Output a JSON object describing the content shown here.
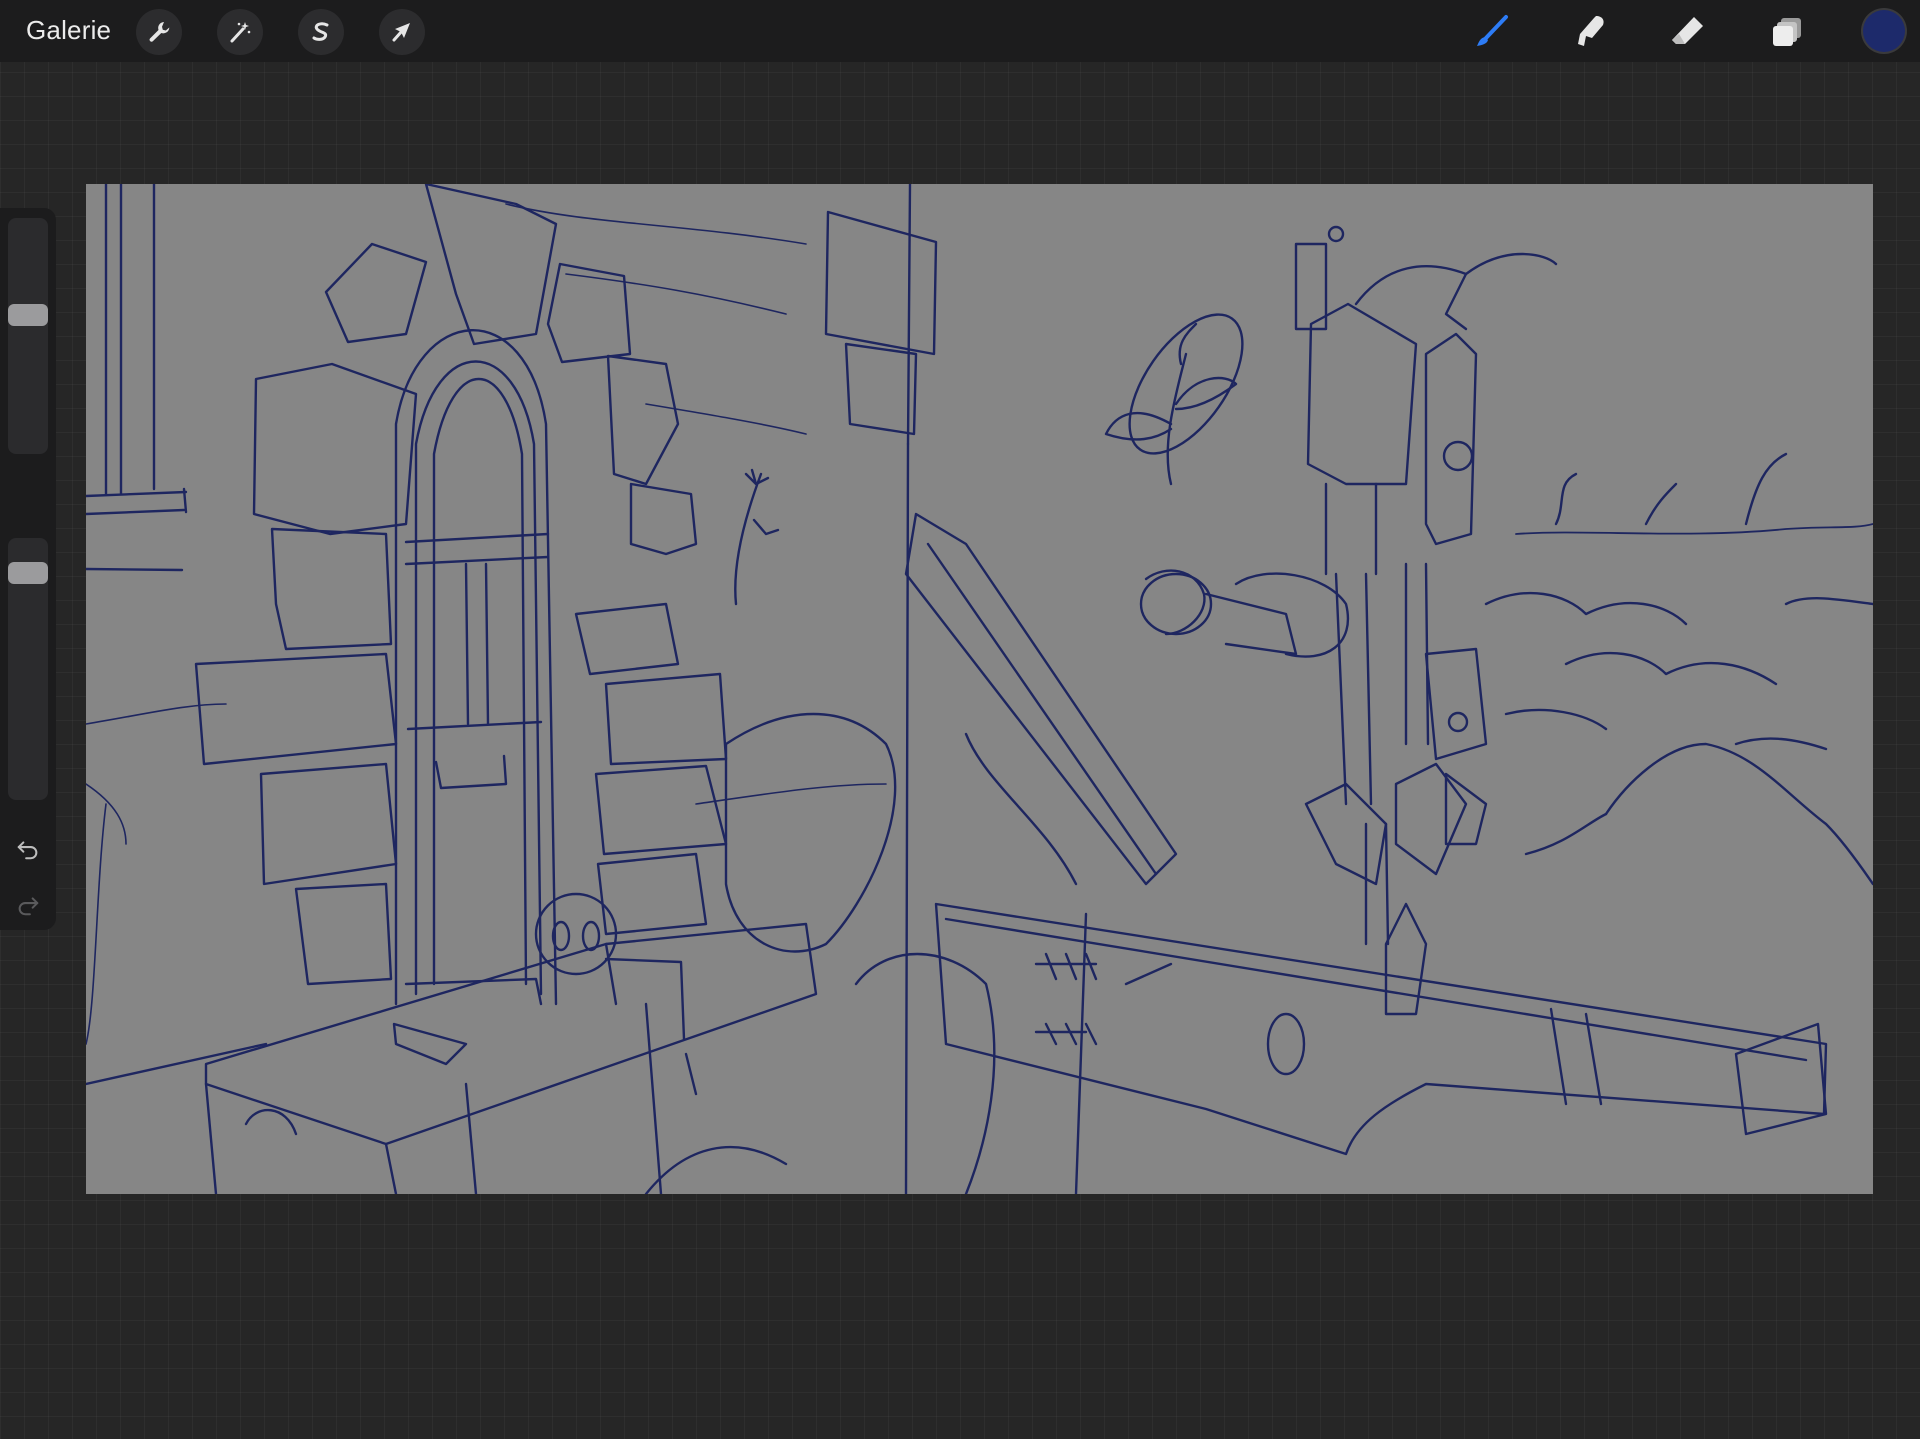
{
  "toolbar": {
    "gallery_label": "Galerie",
    "left_tools": [
      {
        "name": "actions",
        "icon": "wrench-icon"
      },
      {
        "name": "adjustments",
        "icon": "magic-wand-icon"
      },
      {
        "name": "selection",
        "icon": "selection-s-icon"
      },
      {
        "name": "transform",
        "icon": "arrow-cursor-icon"
      }
    ],
    "right_tools": [
      {
        "name": "brush",
        "icon": "brush-icon",
        "active": true
      },
      {
        "name": "smudge",
        "icon": "smudge-icon",
        "active": false
      },
      {
        "name": "eraser",
        "icon": "eraser-icon",
        "active": false
      },
      {
        "name": "layers",
        "icon": "layers-icon",
        "active": false
      }
    ],
    "active_color": "#1d2a6b",
    "accent_color": "#2d7cf6"
  },
  "sidebar": {
    "brush_size_level": 0.6,
    "opacity_level": 0.9,
    "buttons": [
      {
        "name": "modify",
        "icon": "square-icon"
      },
      {
        "name": "undo",
        "icon": "undo-icon"
      },
      {
        "name": "redo",
        "icon": "redo-icon"
      }
    ]
  },
  "canvas": {
    "background_color": "#868686",
    "stroke_color": "#1e2660"
  }
}
